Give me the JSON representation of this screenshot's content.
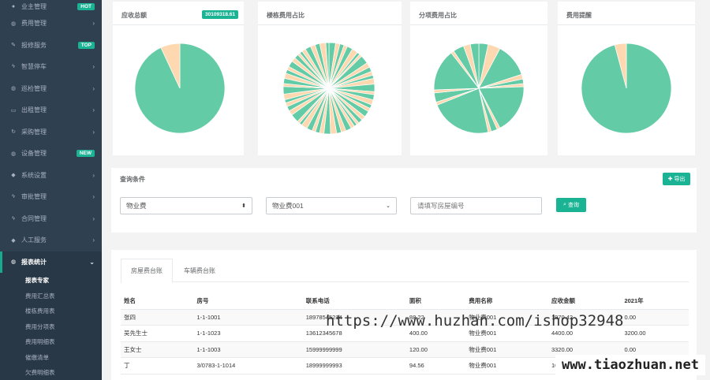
{
  "sidebar": {
    "items": [
      {
        "label": "业主管理",
        "icon": "user-icon",
        "badge": "HOT"
      },
      {
        "label": "费用管理",
        "icon": "globe-icon",
        "badge": ""
      },
      {
        "label": "报修服务",
        "icon": "edit-icon",
        "badge": "TOP"
      },
      {
        "label": "智慧停车",
        "icon": "bolt-icon",
        "badge": ""
      },
      {
        "label": "巡检管理",
        "icon": "globe-icon",
        "badge": ""
      },
      {
        "label": "出租管理",
        "icon": "monitor-icon",
        "badge": ""
      },
      {
        "label": "采购管理",
        "icon": "refresh-icon",
        "badge": ""
      },
      {
        "label": "设备管理",
        "icon": "globe-icon",
        "badge": "NEW"
      },
      {
        "label": "系统设置",
        "icon": "diamond-icon",
        "badge": ""
      },
      {
        "label": "审批管理",
        "icon": "bolt-icon",
        "badge": ""
      },
      {
        "label": "合同管理",
        "icon": "bolt-icon",
        "badge": ""
      },
      {
        "label": "人工服务",
        "icon": "diamond-icon",
        "badge": ""
      },
      {
        "label": "报表统计",
        "icon": "globe-icon",
        "badge": ""
      }
    ],
    "sub_items": [
      "报表专家",
      "费用汇总表",
      "楼栋费用表",
      "费用分项表",
      "费用明细表",
      "催缴清单",
      "欠费明细表"
    ]
  },
  "cards": [
    {
      "title": "应收总额",
      "amount": "30109318.61"
    },
    {
      "title": "楼栋费用占比"
    },
    {
      "title": "分项费用占比"
    },
    {
      "title": "费用提醒"
    }
  ],
  "pie_colors": {
    "main": "#63cba5",
    "secondary": "#fdd8b0",
    "stroke": "#ffffff"
  },
  "filter": {
    "title": "查询条件",
    "export_label": "导出",
    "fee_type": "物业费",
    "fee_item": "物业费001",
    "room_placeholder": "请填写房屋编号",
    "search_label": "查询"
  },
  "tabs": [
    "房屋费台账",
    "车辆费台账"
  ],
  "table": {
    "headers": [
      "姓名",
      "房号",
      "联系电话",
      "面积",
      "费用名称",
      "应收金额",
      "2021年"
    ],
    "rows": [
      [
        "张四",
        "1-1-1001",
        "18978545214",
        "88.22",
        "物业费001",
        "1970.42",
        "0.00"
      ],
      [
        "吴先生士",
        "1-1-1023",
        "13612345678",
        "400.00",
        "物业费001",
        "4400.00",
        "3200.00"
      ],
      [
        "王女士",
        "1-1-1003",
        "15999999999",
        "120.00",
        "物业费001",
        "3320.00",
        "0.00"
      ],
      [
        "丁",
        "3/0783-1-1014",
        "18999999993",
        "94.56",
        "物业费001",
        "1040.16",
        "0.00"
      ]
    ]
  },
  "watermarks": {
    "url1": "https://www.huzhan.com/ishop32948",
    "url2": "www.tiaozhuan.net"
  }
}
